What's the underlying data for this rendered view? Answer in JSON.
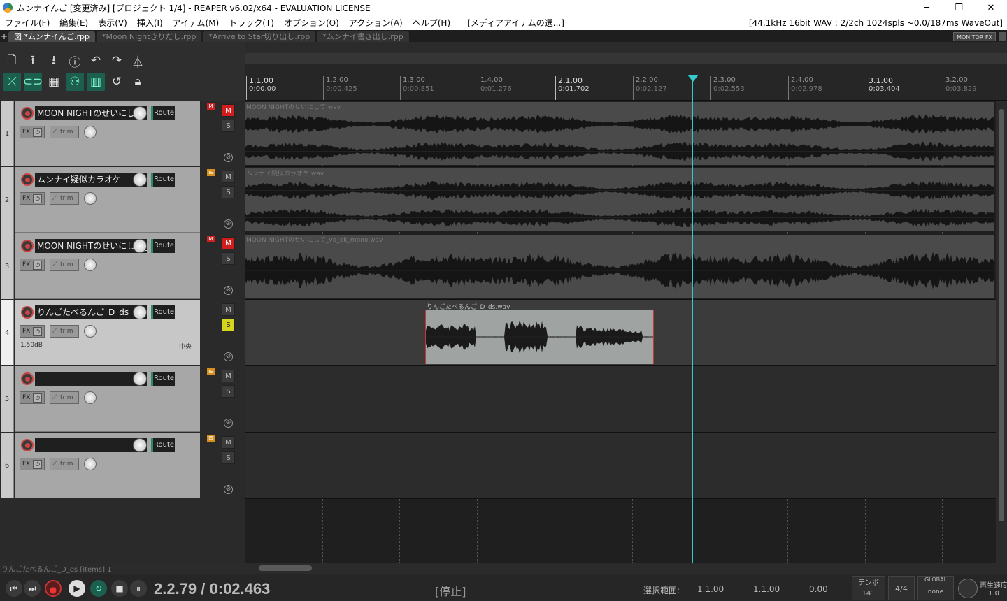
{
  "window": {
    "title": "ムンナイんご [変更済み] [プロジェクト 1/4] - REAPER v6.02/x64 - EVALUATION LICENSE",
    "minimize": "─",
    "maximize": "❐",
    "close": "✕"
  },
  "menu": {
    "items": [
      "ファイル(F)",
      "編集(E)",
      "表示(V)",
      "挿入(I)",
      "アイテム(M)",
      "トラック(T)",
      "オプション(O)",
      "アクション(A)",
      "ヘルプ(H)"
    ],
    "recent": "[メディアアイテムの選...]",
    "status": "[44.1kHz 16bit WAV : 2/2ch 1024spls ~0.0/187ms WaveOut]"
  },
  "tabs": {
    "plus": "+",
    "items": [
      "図 *ムンナイんご.rpp",
      "*Moon Nightきりだし.rpp",
      "*Arrive to Star切り出し.rpp",
      "*ムンナイ書き出し.rpp"
    ],
    "active_index": 0,
    "monitor_fx": "MONITOR FX"
  },
  "ruler": {
    "marks": [
      {
        "bar": "1.1.00",
        "time": "0:00.00",
        "major": true
      },
      {
        "bar": "1.2.00",
        "time": "0:00.425",
        "major": false
      },
      {
        "bar": "1.3.00",
        "time": "0:00.851",
        "major": false
      },
      {
        "bar": "1.4.00",
        "time": "0:01.276",
        "major": false
      },
      {
        "bar": "2.1.00",
        "time": "0:01.702",
        "major": true
      },
      {
        "bar": "2.2.00",
        "time": "0:02.127",
        "major": false
      },
      {
        "bar": "2.3.00",
        "time": "0:02.553",
        "major": false
      },
      {
        "bar": "2.4.00",
        "time": "0:02.978",
        "major": false
      },
      {
        "bar": "3.1.00",
        "time": "0:03.404",
        "major": true
      },
      {
        "bar": "3.2.00",
        "time": "0:03.829",
        "major": false
      }
    ]
  },
  "tracks": [
    {
      "num": "1",
      "name": "MOON NIGHTのせいにして",
      "route": "Route",
      "fx": "FX",
      "trim": "trim",
      "env": "M",
      "env_type": "m",
      "mute": "M",
      "mute_on": true,
      "solo": "S",
      "solo_on": false,
      "item": "MOON NIGHTのせいにして.wav",
      "volume": "",
      "pan": ""
    },
    {
      "num": "2",
      "name": "ムンナイ疑似カラオケ",
      "route": "Route",
      "fx": "FX",
      "trim": "trim",
      "env": "IS",
      "env_type": "is",
      "mute": "M",
      "mute_on": false,
      "solo": "S",
      "solo_on": false,
      "item": "ムンナイ疑似カラオケ.wav",
      "volume": "",
      "pan": ""
    },
    {
      "num": "3",
      "name": "MOON NIGHTのせいにして_",
      "route": "Route",
      "fx": "FX",
      "trim": "trim",
      "env": "M",
      "env_type": "m",
      "mute": "M",
      "mute_on": true,
      "solo": "S",
      "solo_on": false,
      "item": "MOON NIGHTのせいにして_vo_ok_mono.wav",
      "volume": "",
      "pan": ""
    },
    {
      "num": "4",
      "name": "りんごたべるんご_D_ds",
      "route": "Route",
      "fx": "FX",
      "trim": "trim",
      "env": "",
      "env_type": "",
      "mute": "M",
      "mute_on": false,
      "solo": "S",
      "solo_on": true,
      "item": "りんごたべるんご_D_ds.wav",
      "volume": "1.50dB",
      "pan": "中央"
    },
    {
      "num": "5",
      "name": "",
      "route": "Route",
      "fx": "FX",
      "trim": "trim",
      "env": "IS",
      "env_type": "is",
      "mute": "M",
      "mute_on": false,
      "solo": "S",
      "solo_on": false,
      "item": "",
      "volume": "",
      "pan": ""
    },
    {
      "num": "6",
      "name": "",
      "route": "Route",
      "fx": "FX",
      "trim": "trim",
      "env": "IS",
      "env_type": "is",
      "mute": "M",
      "mute_on": false,
      "solo": "S",
      "solo_on": false,
      "item": "",
      "volume": "",
      "pan": ""
    }
  ],
  "tcp_status": "りんごたべるんご_D_ds [items] 1",
  "transport": {
    "position": "2.2.79 / 0:02.463",
    "state": "[停止]",
    "selection_label": "選択範囲:",
    "sel_start": "1.1.00",
    "sel_end": "1.1.00",
    "sel_length": "0.00",
    "tempo_label": "テンポ",
    "tempo": "141",
    "time_signature": "4/4",
    "global_label": "GLOBAL",
    "global_value": "none",
    "rate_label": "再生速度",
    "rate": "1.0"
  },
  "colors": {
    "accent": "#33cccc",
    "mute_on": "#d21d1d",
    "solo_on": "#d5d51e",
    "record": "#cc3333"
  }
}
